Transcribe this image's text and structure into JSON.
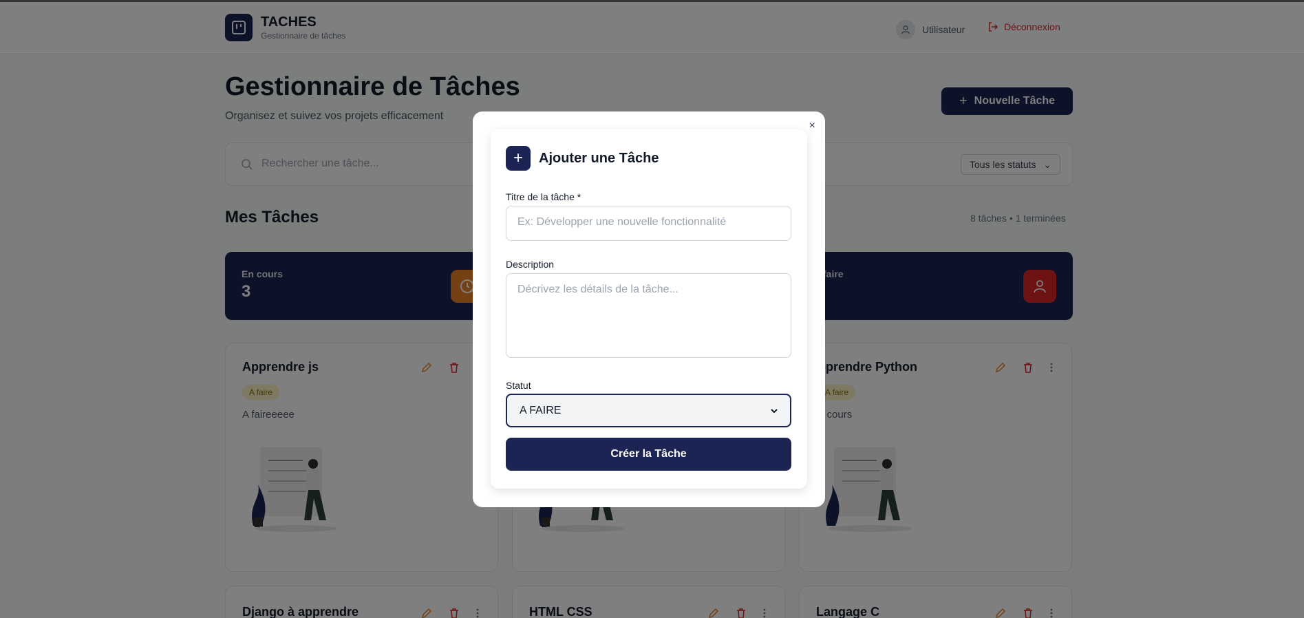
{
  "header": {
    "brand_title": "TACHES",
    "brand_subtitle": "Gestionnaire de tâches",
    "user_label": "Utilisateur",
    "logout_label": "Déconnexion"
  },
  "page": {
    "title": "Gestionnaire de Tâches",
    "subtitle": "Organisez et suivez vos projets efficacement",
    "new_task_label": "Nouvelle Tâche"
  },
  "filters": {
    "search_placeholder": "Rechercher une tâche...",
    "status_filter": "Tous les statuts"
  },
  "tasks_section": {
    "title": "Mes Tâches",
    "counts": "8 tâches  •  1 terminées"
  },
  "stats": [
    {
      "label": "En cours",
      "value": "3",
      "color": "#e8822b"
    },
    {
      "label": "faire",
      "value": "",
      "color": "#dc2626"
    }
  ],
  "tasks": [
    {
      "title": "Apprendre js",
      "badge": "A faire",
      "description": "A faireeeee"
    },
    {
      "title": "pprendre Python",
      "badge": "A faire",
      "description": "n cours"
    },
    {
      "title": "Django à apprendre"
    },
    {
      "title": "HTML CSS"
    },
    {
      "title": "Langage C"
    }
  ],
  "modal": {
    "title": "Ajouter une Tâche",
    "close": "×",
    "title_label": "Titre de la tâche *",
    "title_placeholder": "Ex: Développer une nouvelle fonctionnalité",
    "description_label": "Description",
    "description_placeholder": "Décrivez les détails de la tâche...",
    "status_label": "Statut",
    "status_value": "A FAIRE",
    "submit_label": "Créer la Tâche"
  },
  "colors": {
    "primary": "#1b2453",
    "danger": "#dc2626",
    "warning": "#e8822b",
    "badge_bg": "#fdf3c4"
  }
}
